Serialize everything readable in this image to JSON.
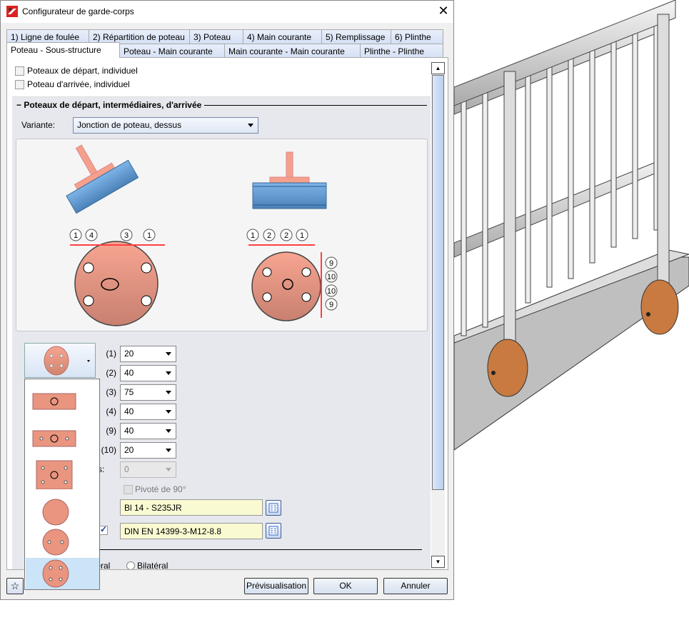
{
  "window": {
    "title": "Configurateur de garde-corps",
    "close_icon": "close-icon",
    "app_icon": "app-logo-icon"
  },
  "tabs_row1": [
    "1) Ligne de foulée",
    "2) Répartition de poteau",
    "3) Poteau",
    "4) Main courante",
    "5) Remplissage",
    "6) Plinthe"
  ],
  "tabs_row2": [
    "Poteau - Sous-structure",
    "Poteau - Main courante",
    "Main courante - Main courante",
    "Plinthe - Plinthe"
  ],
  "active_tab": "Poteau - Sous-structure",
  "checkboxes": {
    "start": {
      "label": "Poteaux de départ, individuel",
      "checked": false
    },
    "end": {
      "label": "Poteau d'arrivée, individuel",
      "checked": false
    }
  },
  "group": {
    "title": "Poteaux de départ, intermédiaires, d'arrivée",
    "variant_label": "Variante:",
    "variant_value": "Jonction de poteau, dessus"
  },
  "diagram": {
    "left_labels": [
      "1",
      "4",
      "3",
      "1"
    ],
    "right_labels": [
      "1",
      "2",
      "2",
      "1"
    ],
    "vertical_labels": [
      "9",
      "10",
      "10",
      "9"
    ],
    "plate_color": "#e9957f",
    "beam_color": "#5b9bd5",
    "dim_color": "#ff4040"
  },
  "fields": [
    {
      "label": "(1)",
      "value": "20"
    },
    {
      "label": "(2)",
      "value": "40"
    },
    {
      "label": "(3)",
      "value": "75"
    },
    {
      "label": "(4)",
      "value": "40"
    },
    {
      "label": "(9)",
      "value": "40"
    },
    {
      "label": "(10)",
      "value": "20"
    }
  ],
  "pins": {
    "label": "pins:",
    "value": "0",
    "disabled": true
  },
  "rotated": {
    "label": "Pivoté de 90°",
    "checked": false,
    "disabled": true
  },
  "material": "Bl 14 - S235JR",
  "bolt": {
    "value": "DIN EN 14399-3-M12-8.8",
    "checked": true
  },
  "radios": {
    "left_fragment": "téral",
    "right": "Bilatéral"
  },
  "plate_dropdown": {
    "options": [
      "rect-1-hole",
      "rect-3-holes",
      "rect-5-holes",
      "round-plain",
      "round-4-holes-small",
      "round-4-holes"
    ],
    "selected_index": 5
  },
  "buttons": {
    "preview": "Prévisualisation",
    "ok": "OK",
    "cancel": "Annuler",
    "favorite_icon": "star-icon"
  }
}
